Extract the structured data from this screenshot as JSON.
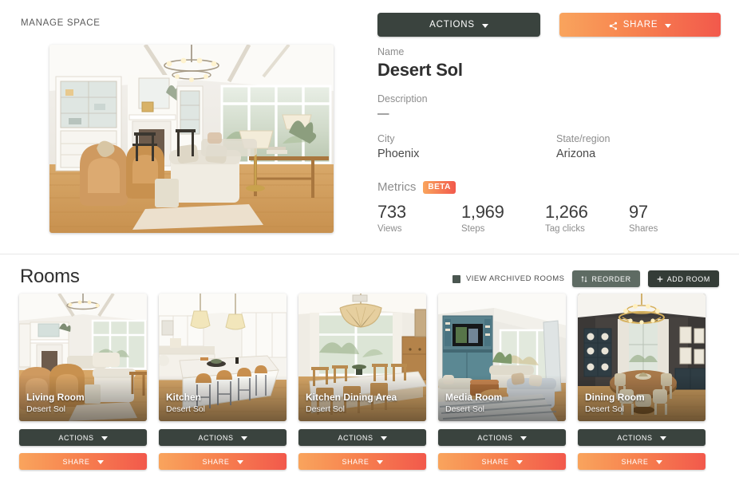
{
  "breadcrumb": "MANAGE SPACE",
  "toolbar": {
    "actions_label": "ACTIONS",
    "share_label": "SHARE",
    "share_icon": "share-nodes-icon",
    "caret_icon": "caret-down-icon"
  },
  "hero": {
    "alt": "living-room-panorama",
    "name": "Desert Sol living room"
  },
  "details": {
    "name_label": "Name",
    "name_value": "Desert Sol",
    "description_label": "Description",
    "description_value": "—",
    "city_label": "City",
    "city_value": "Phoenix",
    "state_label": "State/region",
    "state_value": "Arizona"
  },
  "metrics": {
    "title": "Metrics",
    "badge": "BETA",
    "items": [
      {
        "value": "733",
        "label": "Views"
      },
      {
        "value": "1,969",
        "label": "Steps"
      },
      {
        "value": "1,266",
        "label": "Tag clicks"
      },
      {
        "value": "97",
        "label": "Shares"
      }
    ]
  },
  "rooms": {
    "title": "Rooms",
    "archived_label": "VIEW ARCHIVED ROOMS",
    "reorder_label": "REORDER",
    "reorder_icon": "sort-icon",
    "add_room_label": "ADD ROOM",
    "add_room_icon": "plus-icon",
    "card_actions_label": "ACTIONS",
    "card_share_label": "SHARE",
    "items": [
      {
        "room": "Living Room",
        "space": "Desert Sol",
        "scene": "living"
      },
      {
        "room": "Kitchen",
        "space": "Desert Sol",
        "scene": "kitchen"
      },
      {
        "room": "Kitchen Dining Area",
        "space": "Desert Sol",
        "scene": "kitchendining"
      },
      {
        "room": "Media Room",
        "space": "Desert Sol",
        "scene": "media"
      },
      {
        "room": "Dining Room",
        "space": "Desert Sol",
        "scene": "dining"
      }
    ]
  },
  "colors": {
    "dark": "#3a433e",
    "orange_start": "#f9a45d",
    "orange_end": "#f2594c",
    "reorder": "#5e6b63",
    "add_room": "#343c37",
    "text": "#3c3c3c",
    "muted": "#8d8d8d"
  }
}
